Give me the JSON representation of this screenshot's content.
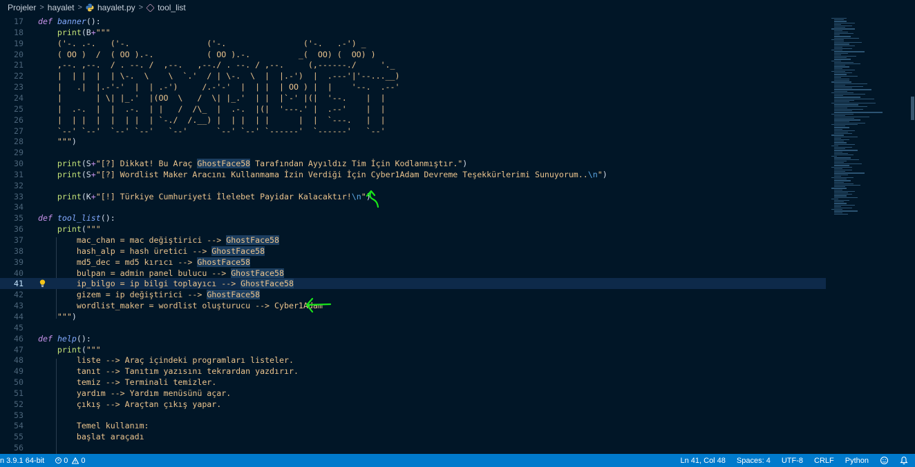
{
  "breadcrumb": {
    "items": [
      "Projeler",
      "hayalet",
      "hayalet.py",
      "tool_list"
    ]
  },
  "editor": {
    "active_line": 41,
    "lines": [
      {
        "n": "17",
        "segs": [
          [
            "kw-def",
            "def"
          ],
          [
            "plain",
            " "
          ],
          [
            "fn",
            "banner"
          ],
          [
            "plain",
            "():"
          ]
        ]
      },
      {
        "n": "18",
        "segs": [
          [
            "plain",
            "    "
          ],
          [
            "bi",
            "print"
          ],
          [
            "plain",
            "(B"
          ],
          [
            "op",
            "+"
          ],
          [
            "str",
            "\"\"\""
          ]
        ]
      },
      {
        "n": "19",
        "segs": [
          [
            "str",
            "    ('-. .-.   ('-.                ('-.                ('-.   .-') _"
          ]
        ]
      },
      {
        "n": "20",
        "segs": [
          [
            "str",
            "    ( OO )  /  ( OO ).-.           ( OO ).-.          _(  OO) (  OO) )"
          ]
        ]
      },
      {
        "n": "21",
        "segs": [
          [
            "str",
            "    ,--. ,--.  / . --. /  ,--.   ,--./ . --. / ,--.     (,------./     '._"
          ]
        ]
      },
      {
        "n": "22",
        "segs": [
          [
            "str",
            "    |  | |  |  | \\-.  \\    \\  `.'  / | \\-.  \\  |  |.-')  |  .---'|'--...__)"
          ]
        ]
      },
      {
        "n": "23",
        "segs": [
          [
            "str",
            "    |   .|  |.-'-'  |  | .-')     /.-'-'  |  | |  | OO ) |  |    '--.  .--'"
          ]
        ]
      },
      {
        "n": "24",
        "segs": [
          [
            "str",
            "    |       | \\| |_.'  |(OO  \\   /  \\| |_.'  | |  |`-' |(|  '--.    |  |"
          ]
        ]
      },
      {
        "n": "25",
        "segs": [
          [
            "str",
            "    |  .-.  |  |  .-.  | |   /  /\\_  |  .-.  |(|  '---.' |  .--'    |  |"
          ]
        ]
      },
      {
        "n": "26",
        "segs": [
          [
            "str",
            "    |  | |  |  |  | |  | `-./  /.__) |  | |  | |      |  |  `---.   |  |"
          ]
        ]
      },
      {
        "n": "27",
        "segs": [
          [
            "str",
            "    `--' `--'  `--' `--'   `--'      `--' `--' `------'  `------'   `--'"
          ]
        ]
      },
      {
        "n": "28",
        "segs": [
          [
            "str",
            "    \"\"\""
          ],
          [
            "plain",
            ")"
          ]
        ]
      },
      {
        "n": "29",
        "segs": []
      },
      {
        "n": "30",
        "segs": [
          [
            "plain",
            "    "
          ],
          [
            "bi",
            "print"
          ],
          [
            "plain",
            "(S"
          ],
          [
            "op",
            "+"
          ],
          [
            "str",
            "\"[?] Dikkat! Bu Araç "
          ],
          [
            "str hl",
            "GhostFace58"
          ],
          [
            "str",
            " Tarafından Ayyıldız Tim İçin Kodlanmıştır.\""
          ],
          [
            "plain",
            ")"
          ]
        ]
      },
      {
        "n": "31",
        "segs": [
          [
            "plain",
            "    "
          ],
          [
            "bi",
            "print"
          ],
          [
            "plain",
            "(S"
          ],
          [
            "op",
            "+"
          ],
          [
            "str",
            "\"[?] Wordlist Maker Aracını Kullanmama İzin Verdiği İçin Cyber1Adam Devreme Teşekkürlerimi Sunuyorum.."
          ],
          [
            "esc",
            "\\n"
          ],
          [
            "str",
            "\""
          ],
          [
            "plain",
            ")"
          ]
        ]
      },
      {
        "n": "32",
        "segs": []
      },
      {
        "n": "33",
        "segs": [
          [
            "plain",
            "    "
          ],
          [
            "bi",
            "print"
          ],
          [
            "plain",
            "(K"
          ],
          [
            "op",
            "+"
          ],
          [
            "str",
            "\"[!] Türkiye Cumhuriyeti İlelebet Payidar Kalacaktır!"
          ],
          [
            "esc",
            "\\n"
          ],
          [
            "str",
            "\""
          ],
          [
            "plain",
            ")"
          ]
        ]
      },
      {
        "n": "34",
        "segs": []
      },
      {
        "n": "35",
        "segs": [
          [
            "kw-def",
            "def"
          ],
          [
            "plain",
            " "
          ],
          [
            "fn",
            "tool_list"
          ],
          [
            "plain",
            "():"
          ]
        ]
      },
      {
        "n": "36",
        "segs": [
          [
            "plain",
            "    "
          ],
          [
            "bi",
            "print"
          ],
          [
            "plain",
            "("
          ],
          [
            "str",
            "\"\"\""
          ]
        ]
      },
      {
        "n": "37",
        "segs": [
          [
            "str",
            "        mac_chan = mac değiştirici --> "
          ],
          [
            "str hl",
            "GhostFace58"
          ]
        ]
      },
      {
        "n": "38",
        "segs": [
          [
            "str",
            "        hash_alp = hash üretici --> "
          ],
          [
            "str hl",
            "GhostFace58"
          ]
        ]
      },
      {
        "n": "39",
        "segs": [
          [
            "str",
            "        md5_dec = md5 kırıcı --> "
          ],
          [
            "str hl",
            "GhostFace58"
          ]
        ]
      },
      {
        "n": "40",
        "segs": [
          [
            "str",
            "        bulpan = admin panel bulucu --> "
          ],
          [
            "str hl",
            "GhostFace58"
          ]
        ]
      },
      {
        "n": "41",
        "segs": [
          [
            "str",
            "        ip_bilgo = ip bilgi toplayıcı --> "
          ],
          [
            "str hl",
            "GhostFace58"
          ]
        ]
      },
      {
        "n": "42",
        "segs": [
          [
            "str",
            "        gizem = ip değiştirici --> "
          ],
          [
            "str hl",
            "GhostFace58"
          ]
        ]
      },
      {
        "n": "43",
        "segs": [
          [
            "str",
            "        wordlist_maker = wordlist oluşturucu --> Cyber1Adam"
          ]
        ]
      },
      {
        "n": "44",
        "segs": [
          [
            "str",
            "    \"\"\""
          ],
          [
            "plain",
            ")"
          ]
        ]
      },
      {
        "n": "45",
        "segs": []
      },
      {
        "n": "46",
        "segs": [
          [
            "kw-def",
            "def"
          ],
          [
            "plain",
            " "
          ],
          [
            "fn",
            "help"
          ],
          [
            "plain",
            "():"
          ]
        ]
      },
      {
        "n": "47",
        "segs": [
          [
            "plain",
            "    "
          ],
          [
            "bi",
            "print"
          ],
          [
            "plain",
            "("
          ],
          [
            "str",
            "\"\"\""
          ]
        ]
      },
      {
        "n": "48",
        "segs": [
          [
            "str",
            "        liste --> Araç içindeki programları listeler."
          ]
        ]
      },
      {
        "n": "49",
        "segs": [
          [
            "str",
            "        tanıt --> Tanıtım yazısını tekrardan yazdırır."
          ]
        ]
      },
      {
        "n": "50",
        "segs": [
          [
            "str",
            "        temiz --> Terminali temizler."
          ]
        ]
      },
      {
        "n": "51",
        "segs": [
          [
            "str",
            "        yardım --> Yardım menüsünü açar."
          ]
        ]
      },
      {
        "n": "52",
        "segs": [
          [
            "str",
            "        çıkış --> Araçtan çıkış yapar."
          ]
        ]
      },
      {
        "n": "53",
        "segs": []
      },
      {
        "n": "54",
        "segs": [
          [
            "str",
            "        Temel kullanım:"
          ]
        ]
      },
      {
        "n": "55",
        "segs": [
          [
            "str",
            "        başlat araçadı"
          ]
        ]
      },
      {
        "n": "56",
        "segs": []
      }
    ]
  },
  "statusbar": {
    "interpreter": "n 3.9.1 64-bit",
    "errors": "0",
    "warnings": "0",
    "cursor": "Ln 41, Col 48",
    "spaces": "Spaces: 4",
    "encoding": "UTF-8",
    "eol": "CRLF",
    "language": "Python"
  },
  "colors": {
    "background": "#011627",
    "statusbar": "#007acc",
    "annotation": "#19e619"
  },
  "icons": [
    "python-file-icon",
    "symbol-method-icon",
    "lightbulb-icon",
    "error-icon",
    "warning-icon",
    "feedback-icon",
    "bell-icon"
  ]
}
